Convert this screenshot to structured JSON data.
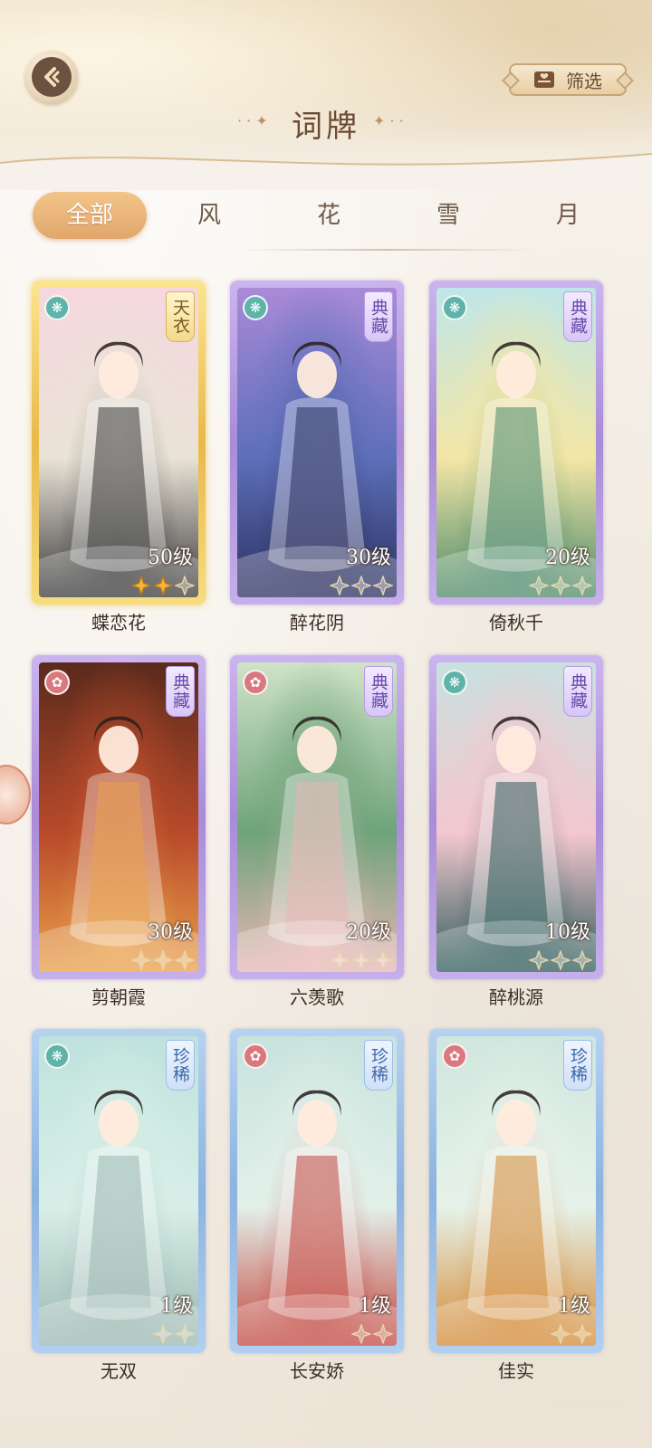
{
  "header": {
    "title": "词牌",
    "filter_label": "筛选"
  },
  "tabs": [
    {
      "label": "全部",
      "active": true
    },
    {
      "label": "风",
      "active": false
    },
    {
      "label": "花",
      "active": false
    },
    {
      "label": "雪",
      "active": false
    },
    {
      "label": "月",
      "active": false
    }
  ],
  "cards": [
    {
      "name": "蝶恋花",
      "tag": "天衣",
      "rarity": "gold",
      "element": "wind",
      "level": "50级",
      "stars_filled": 2,
      "stars_total": 3
    },
    {
      "name": "醉花阴",
      "tag": "典藏",
      "rarity": "purple",
      "element": "wind",
      "level": "30级",
      "stars_filled": 0,
      "stars_total": 3
    },
    {
      "name": "倚秋千",
      "tag": "典藏",
      "rarity": "purple",
      "element": "wind",
      "level": "20级",
      "stars_filled": 0,
      "stars_total": 3
    },
    {
      "name": "剪朝霞",
      "tag": "典藏",
      "rarity": "purple",
      "element": "flower",
      "level": "30级",
      "stars_filled": 0,
      "stars_total": 3
    },
    {
      "name": "六羡歌",
      "tag": "典藏",
      "rarity": "purple",
      "element": "flower",
      "level": "20级",
      "stars_filled": 0,
      "stars_total": 3
    },
    {
      "name": "醉桃源",
      "tag": "典藏",
      "rarity": "purple",
      "element": "wind",
      "level": "10级",
      "stars_filled": 0,
      "stars_total": 3
    },
    {
      "name": "无双",
      "tag": "珍稀",
      "rarity": "blue",
      "element": "wind",
      "level": "1级",
      "stars_filled": 0,
      "stars_total": 2
    },
    {
      "name": "长安娇",
      "tag": "珍稀",
      "rarity": "blue",
      "element": "flower",
      "level": "1级",
      "stars_filled": 0,
      "stars_total": 2
    },
    {
      "name": "佳实",
      "tag": "珍稀",
      "rarity": "blue",
      "element": "flower",
      "level": "1级",
      "stars_filled": 0,
      "stars_total": 2
    }
  ],
  "icons": {
    "back": "back-arrow-icon",
    "filter": "filter-book-icon",
    "wind": "wind-element-icon",
    "flower": "flower-element-icon",
    "star": "star-icon"
  },
  "colors": {
    "accent": "#e1a66a",
    "title": "#6b4b34",
    "gold_frame": "#e9b94a",
    "purple_frame": "#a98bd8",
    "blue_frame": "#8cb3e0"
  }
}
